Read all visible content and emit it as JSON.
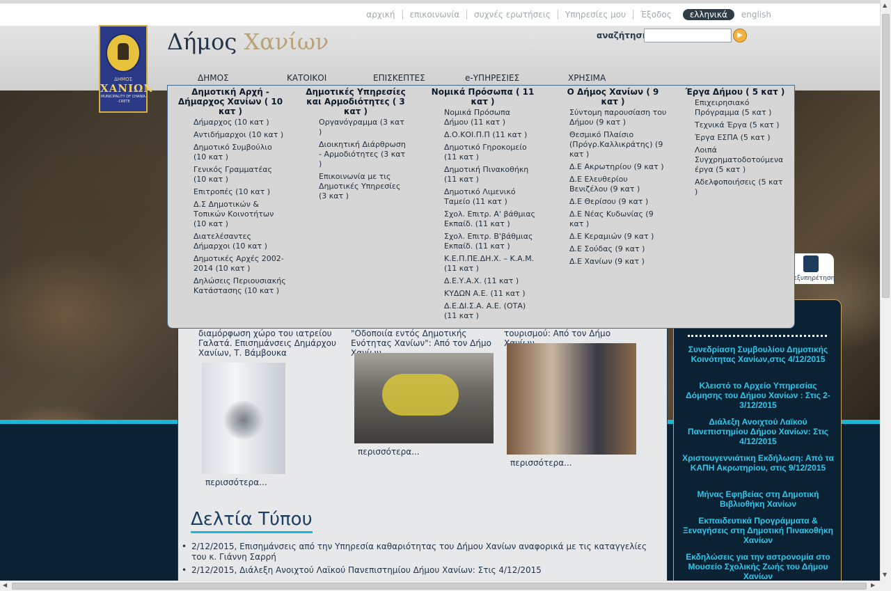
{
  "top_links": [
    "αρχική",
    "επικοινωνία",
    "συχνές ερωτήσεις",
    "Υπηρεσίες μου",
    "Έξοδος"
  ],
  "lang_active": "ελληνικά",
  "lang_other": "english",
  "logo": {
    "line1": "ΔΗΜΟΣ",
    "line2": "ΧΑΝΙΩΝ",
    "line3": "MUNICIPALITY OF CHANIA · CRETE"
  },
  "site_title": {
    "part1": "Δήμος",
    "part2": "Χανίων"
  },
  "search": {
    "label": "αναζήτηση",
    "value": "",
    "placeholder": ""
  },
  "nav": [
    "ΔΗΜΟΣ",
    "ΚΑΤΟΙΚΟΙ",
    "ΕΠΙΣΚΕΠΤΕΣ",
    "e-ΥΠΗΡΕΣΙΕΣ",
    "ΧΡΗΣΙΜΑ"
  ],
  "dropdown": {
    "columns": [
      {
        "head": "Δημοτική Αρχή - Δήμαρχος Χανίων ( 10 κατ )",
        "items": [
          "Δήμαρχος (10 κατ )",
          "Αντιδήμαρχοι (10 κατ )",
          "Δημοτικό Συμβούλιο (10 κατ )",
          "Γενικός Γραμματέας (10 κατ )",
          "Επιτροπές (10 κατ )",
          "Δ.Σ Δημοτικών & Τοπικών Κοινοτήτων (10 κατ )",
          "Διατελέσαντες Δήμαρχοι (10 κατ )",
          "Δημοτικές Αρχές 2002-2014 (10 κατ )",
          "Δηλώσεις Περιουσιακής Κατάστασης (10 κατ )"
        ]
      },
      {
        "head": "Δημοτικές Υπηρεσίες και Αρμοδιότητες ( 3 κατ )",
        "items": [
          "Οργανόγραμμα (3 κατ )",
          "Διοικητική Διάρθρωση - Αρμοδιότητες (3 κατ )",
          "Επικοινωνία με τις Δημοτικές Υπηρεσίες (3 κατ )"
        ]
      },
      {
        "head": "Νομικά Πρόσωπα ( 11 κατ )",
        "items": [
          "Νομικά Πρόσωπα Δήμου (11 κατ )",
          "Δ.Ο.ΚΟΙ.Π.Π (11 κατ )",
          "Δημοτικό Γηροκομείο (11 κατ )",
          "Δημοτική Πινακοθήκη (11 κατ )",
          "Δημοτικό Λιμενικό Ταμείο (11 κατ )",
          "Σχολ. Επιτρ. Α' βάθμιας Εκπαίδ. (11 κατ )",
          "Σχολ. Επιτρ. Β'βάθμιας Εκπαίδ. (11 κατ )",
          "Κ.Ε.Π.ΠΕ.ΔΗ.Χ. – Κ.Α.Μ. (11 κατ )",
          "Δ.Ε.Υ.Α.Χ. (11 κατ )",
          "ΚΥΔΩΝ Α.Ε. (11 κατ )",
          "Δ.Ε.ΔΙ.Σ.Α. Α.Ε. (ΟΤΑ) (11 κατ )"
        ]
      },
      {
        "head": "Ο Δήμος Χανίων ( 9 κατ )",
        "items": [
          "Σύντομη παρουσίαση του Δήμου (9 κατ )",
          "Θεσμικό Πλαίσιο (Πρόγρ.Καλλικράτης) (9 κατ )",
          "Δ.Ε Ακρωτηρίου (9 κατ )",
          "Δ.Ε Ελευθερίου Βενιζέλου (9 κατ )",
          "Δ.Ε Θερίσου (9 κατ )",
          "Δ.Ε Νέας Κυδωνίας (9 κατ )",
          "Δ.Ε Κεραμιών (9 κατ )",
          "Δ.Ε Σούδας (9 κατ )",
          "Δ.Ε Χανίων (9 κατ )"
        ]
      },
      {
        "head": "Έργα Δήμου ( 5 κατ )",
        "items": [
          "Επιχειρησιακό Πρόγραμμα (5 κατ )",
          "Τεχνικά Έργα (5 κατ )",
          "Έργα ΕΣΠΑ (5 κατ )",
          "Λοιπά Συγχρηματοδοτούμενα έργα (5 κατ )",
          "Αδελφοποιήσεις (5 κατ )"
        ]
      }
    ]
  },
  "news": [
    {
      "text": "διαμόρφωση χώρο του ιατρείου Γαλατά. Επισημάνσεις Δημάρχου Χανίων, Τ. Βάμβουκα",
      "more": "περισσότερα..."
    },
    {
      "text": "\"Οδοποιία εντός Δημοτικής Ενότητας Χανίων\": Από τον Δήμο Χανίων",
      "more": "περισσότερα..."
    },
    {
      "text": "τουρισμού: Από τον Δήμο Χανίων",
      "more": "περισσότερα..."
    }
  ],
  "press": {
    "title": "Δελτία Τύπου",
    "items": [
      "2/12/2015, Επισημάνσεις από την Υπηρεσία καθαριότητας του Δήμου Χανίων αναφορικά με τις καταγγελίες του κ. Γιάννη Σαρρή",
      "2/12/2015, Διάλεξη Ανοιχτού Λαϊκού Πανεπιστημίου Δήμου Χανίων: Στις 4/12/2015"
    ]
  },
  "service_label": "εξυπηρέτηση",
  "sidebar_items": [
    "Συνεδρίαση Συμβουλίου Δημοτικής Κοινότητας Χανίων,στις 4/12/2015",
    "Κλειστό το Αρχείο Υπηρεσίας Δόμησης του Δήμου Χανίων : Στις 2-3/12/2015",
    "Διάλεξη Ανοιχτού Λαϊκού Πανεπιστημίου Δήμου Χανίων: Στις 4/12/2015",
    "Χριστουγεννιάτικη Εκδήλωση: Από τα ΚΑΠΗ Ακρωτηρίου, στις 9/12/2015",
    "Μήνας Εφηβείας στη Δημοτική Βιβλιοθήκη Χανίων",
    "Εκπαιδευτικά Προγράμματα & Ξεναγήσεις στη Δημοτική Πινακοθήκη Χανίων",
    "Εκδηλώσεις για την αστρονομία στο Μουσείο Σχολικής Ζωής του Δήμου Χανίων"
  ]
}
